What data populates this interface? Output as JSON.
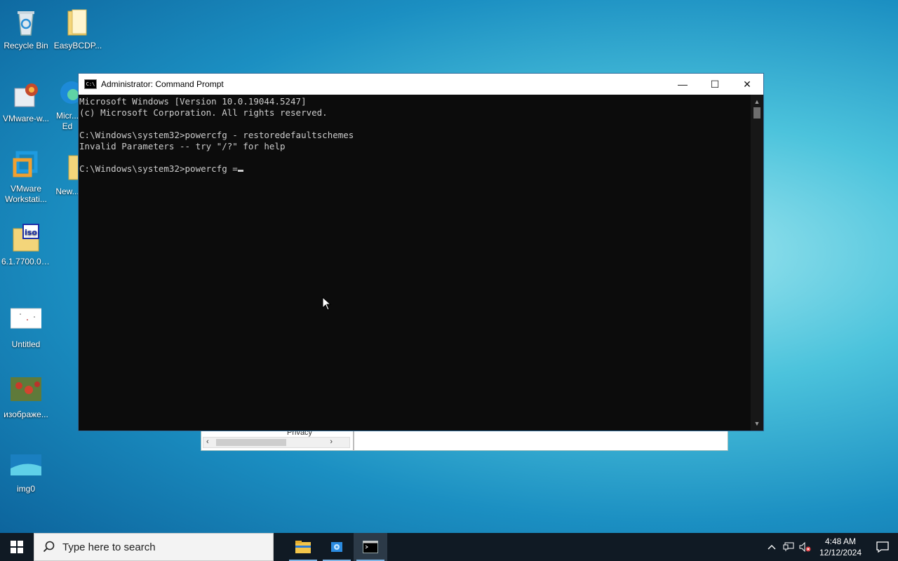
{
  "desktop": {
    "icons": [
      {
        "label": "Recycle Bin"
      },
      {
        "label": "EasyBCDP..."
      },
      {
        "label": "VMware-w..."
      },
      {
        "label": "Micr..."
      },
      {
        "label": "Ed"
      },
      {
        "label": "VMware Workstati..."
      },
      {
        "label": "New..."
      },
      {
        "label": "6.1.7700.0...."
      },
      {
        "label": "Untitled"
      },
      {
        "label": "изображе..."
      },
      {
        "label": "img0"
      }
    ]
  },
  "background_window": {
    "partial_label": "Privacy"
  },
  "cmd_window": {
    "title": "Administrator: Command Prompt",
    "icon_text": "C:\\",
    "minimize": "—",
    "maximize": "☐",
    "close": "✕",
    "lines": [
      "Microsoft Windows [Version 10.0.19044.5247]",
      "(c) Microsoft Corporation. All rights reserved.",
      "",
      "C:\\Windows\\system32>powercfg - restoredefaultschemes",
      "Invalid Parameters -- try \"/?\" for help",
      ""
    ],
    "prompt_line": "C:\\Windows\\system32>powercfg ="
  },
  "taskbar": {
    "search_placeholder": "Type here to search",
    "apps": [
      "file-explorer",
      "setup-app",
      "command-prompt"
    ],
    "clock_time": "4:48 AM",
    "clock_date": "12/12/2024"
  },
  "colors": {
    "taskbar_bg": "#101a24",
    "console_bg": "#0c0c0c",
    "console_text": "#cccccc"
  }
}
